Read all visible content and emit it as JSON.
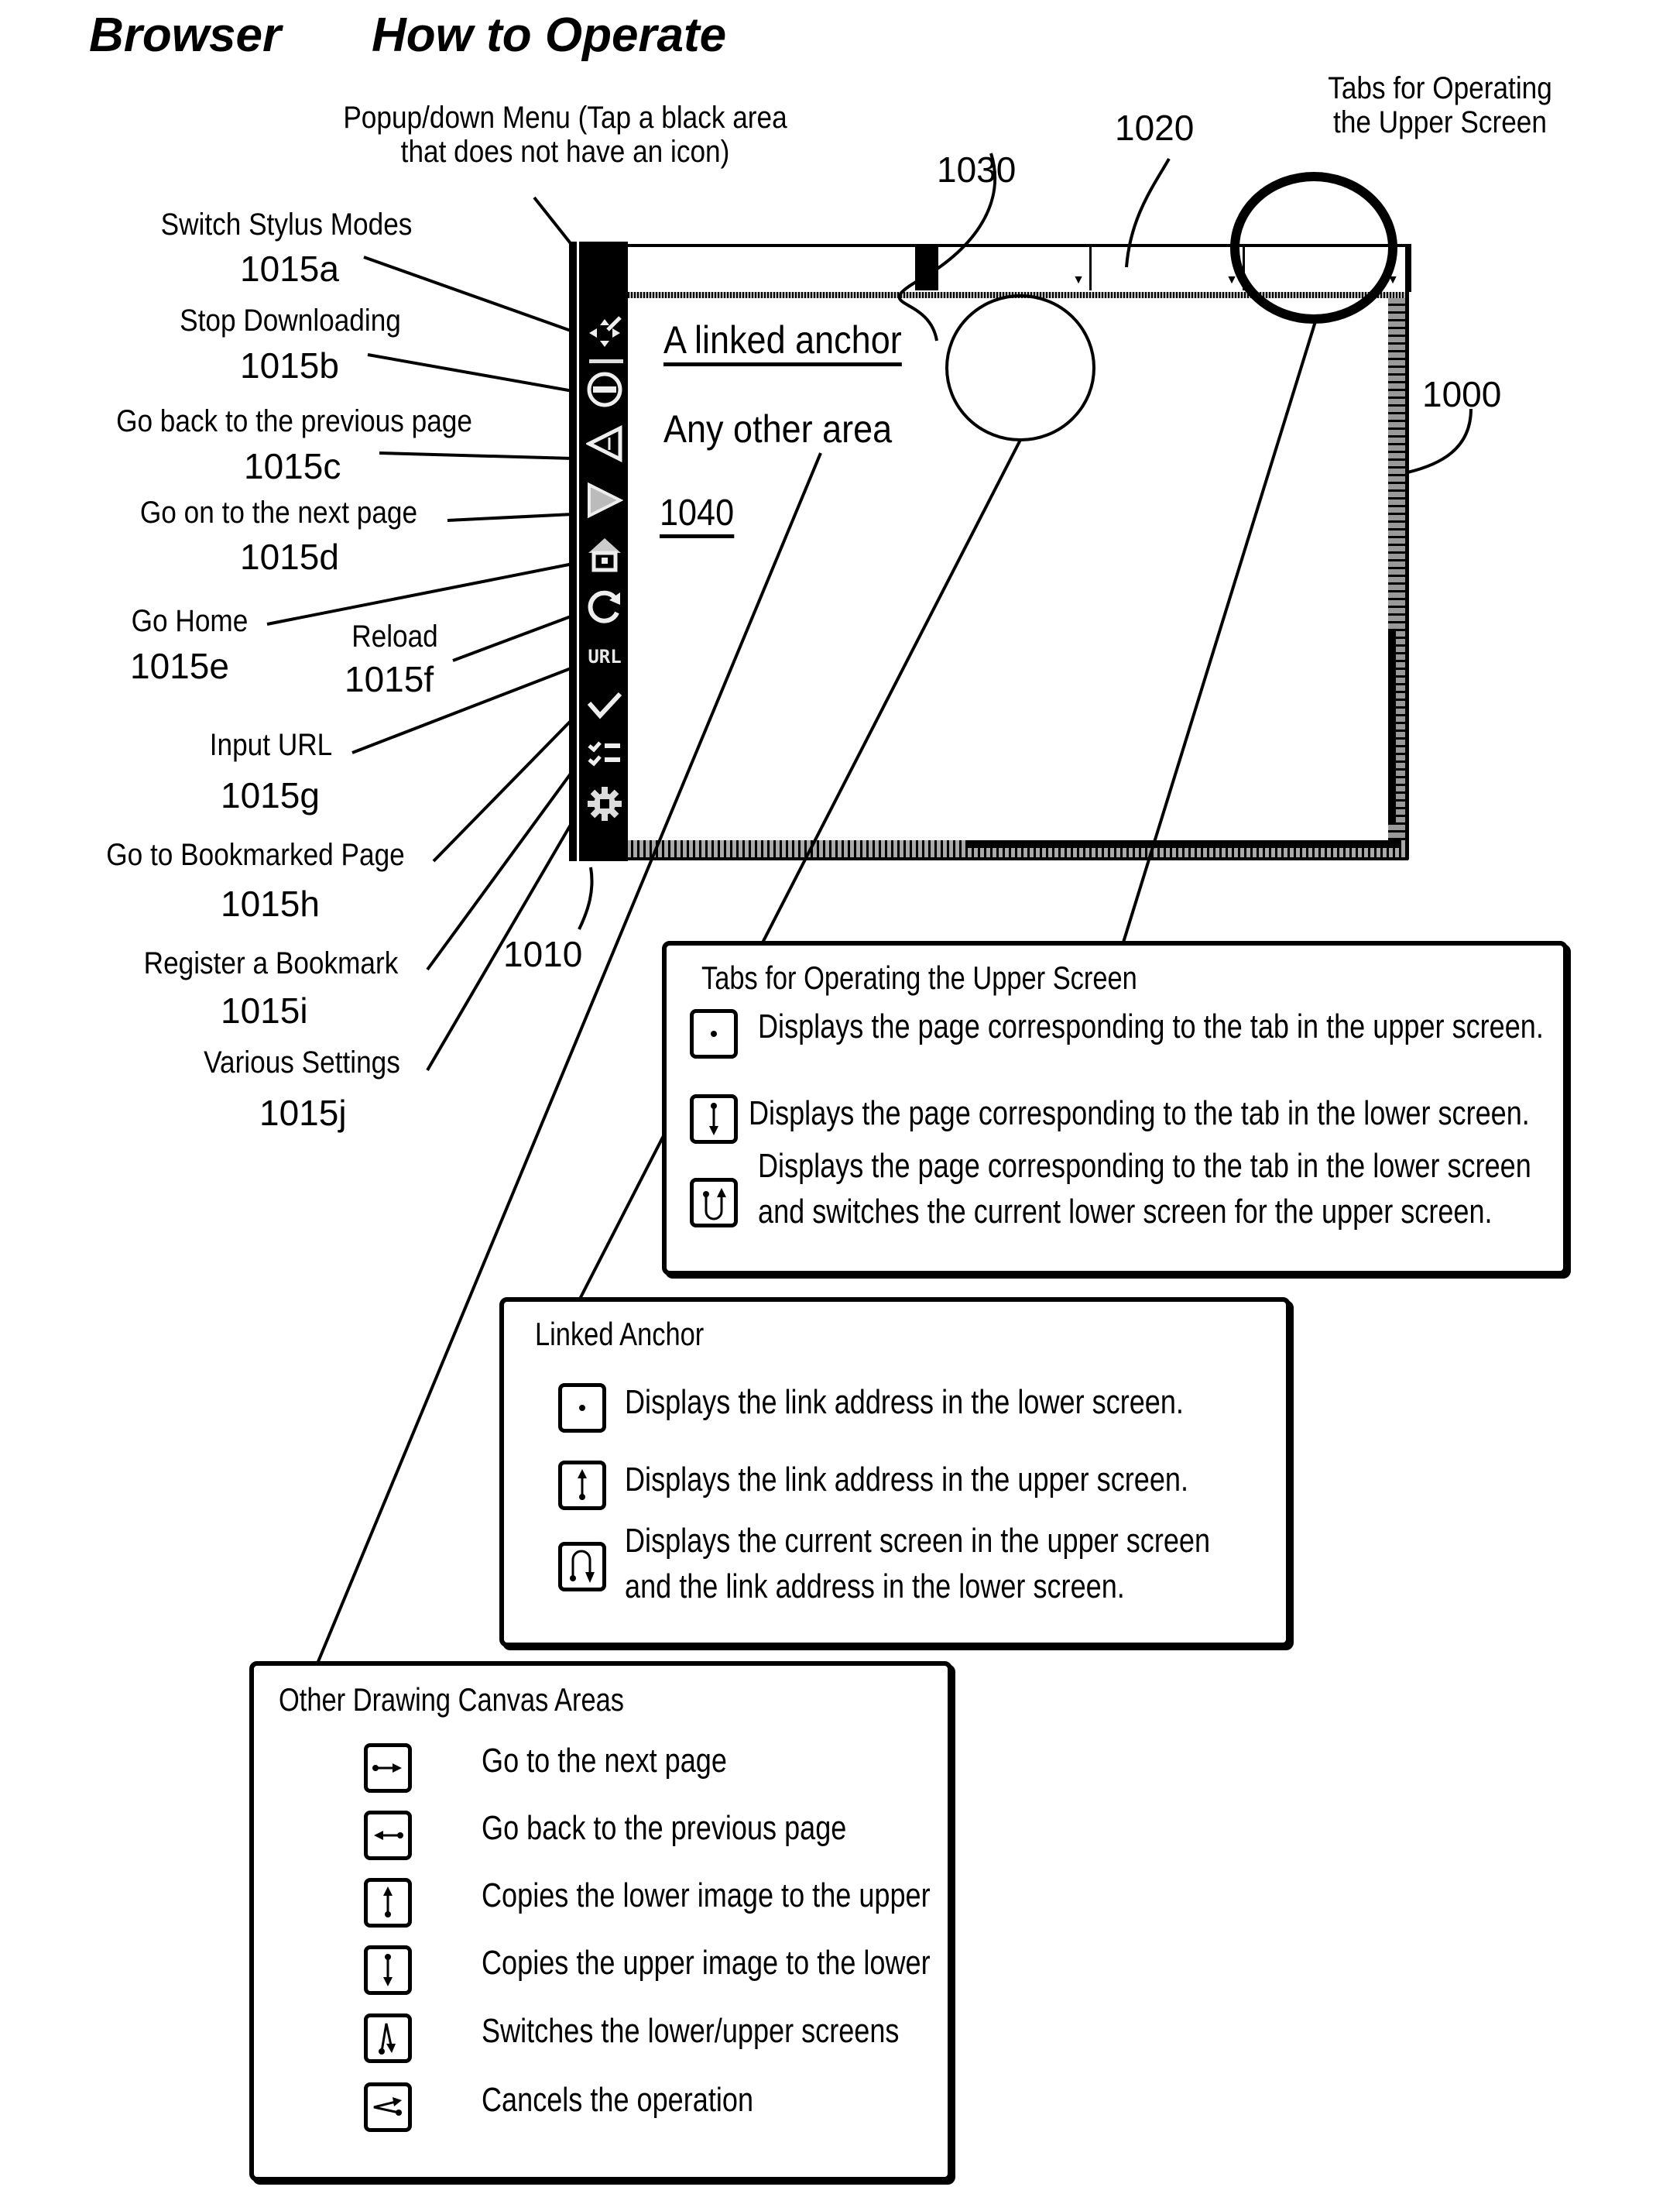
{
  "title": {
    "part1": "Browser",
    "part2": "How to Operate"
  },
  "callouts": {
    "popup_menu": {
      "line1": "Popup/down Menu (Tap a black area",
      "line2": "that does not have an icon)"
    },
    "tabs_upper": {
      "line1": "Tabs for Operating",
      "line2": "the Upper Screen"
    },
    "ref_1020": "1020",
    "ref_1030": "1030",
    "ref_1000": "1000",
    "ref_1010": "1010"
  },
  "toolbar_items": [
    {
      "label": "Switch Stylus Modes",
      "ref": "1015a",
      "icon": "stylus-mode-icon"
    },
    {
      "label": "Stop Downloading",
      "ref": "1015b",
      "icon": "stop-icon"
    },
    {
      "label": "Go back to the previous page",
      "ref": "1015c",
      "icon": "back-icon"
    },
    {
      "label": "Go on to the next page",
      "ref": "1015d",
      "icon": "forward-icon"
    },
    {
      "label": "Go Home",
      "ref": "1015e",
      "icon": "home-icon"
    },
    {
      "label": "Reload",
      "ref": "1015f",
      "icon": "reload-icon"
    },
    {
      "label": "Input URL",
      "ref": "1015g",
      "icon": "url-icon",
      "glyph": "URL"
    },
    {
      "label": "Go to Bookmarked Page",
      "ref": "1015h",
      "icon": "bookmark-check-icon"
    },
    {
      "label": "Register a Bookmark",
      "ref": "1015i",
      "icon": "bookmark-list-icon"
    },
    {
      "label": "Various Settings",
      "ref": "1015j",
      "icon": "gear-icon"
    }
  ],
  "content": {
    "linked_anchor": "A linked anchor",
    "other_area": "Any other area",
    "ref_1040": "1040"
  },
  "boxes": {
    "tabs": {
      "title": "Tabs for Operating the Upper Screen",
      "rows": [
        {
          "icon": "dot-gesture-icon",
          "text": "Displays the page corresponding to the tab in the upper screen."
        },
        {
          "icon": "down-gesture-icon",
          "text": "Displays the page corresponding to the tab in the lower screen."
        },
        {
          "icon": "u-turn-up-gesture-icon",
          "text": "Displays the page corresponding to the tab in the lower screen",
          "text2": "and switches the current lower screen for the upper screen."
        }
      ]
    },
    "anchor": {
      "title": "Linked Anchor",
      "rows": [
        {
          "icon": "dot-gesture-icon",
          "text": "Displays the link address in the lower screen."
        },
        {
          "icon": "up-gesture-icon",
          "text": "Displays the link address in the upper screen."
        },
        {
          "icon": "n-turn-down-gesture-icon",
          "text": "Displays the current screen in the upper screen",
          "text2": "and the link address in the lower screen."
        }
      ]
    },
    "canvas": {
      "title": "Other Drawing Canvas Areas",
      "rows": [
        {
          "icon": "right-gesture-icon",
          "text": "Go to the next page"
        },
        {
          "icon": "left-gesture-icon",
          "text": "Go back to the previous page"
        },
        {
          "icon": "up-gesture-icon",
          "text": "Copies the lower image to the upper"
        },
        {
          "icon": "down-gesture-icon",
          "text": "Copies the upper image to the lower"
        },
        {
          "icon": "up-down-gesture-icon",
          "text": "Switches the lower/upper screens"
        },
        {
          "icon": "zigzag-gesture-icon",
          "text": "Cancels the operation"
        }
      ]
    }
  }
}
